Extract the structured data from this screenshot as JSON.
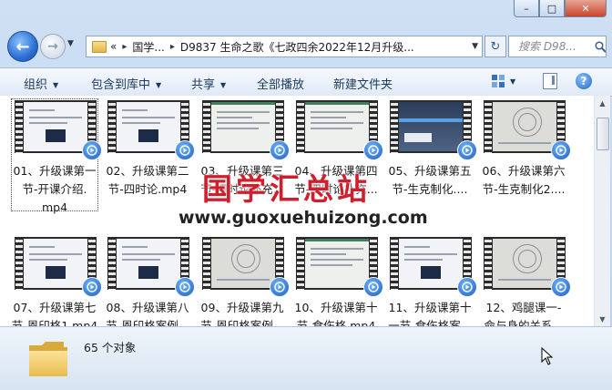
{
  "window": {
    "minimize_glyph": "–",
    "maximize_glyph": "□",
    "close_glyph": "✕"
  },
  "address": {
    "chevrons": "«",
    "segments": [
      "国学...",
      "D9837 生命之歌《七政四余2022年12月升级..."
    ],
    "separator": "▸"
  },
  "search": {
    "placeholder": "搜索 D98..."
  },
  "toolbar": {
    "organize": "组织",
    "include_in_library": "包含到库中",
    "share": "共享",
    "play_all": "全部播放",
    "new_folder": "新建文件夹"
  },
  "files": [
    {
      "label": "01、升级课第一节-开课介绍.mp4",
      "line1": "01、升级课第一",
      "line2": "节-开课介绍.",
      "line3": "mp4",
      "thumb": "a",
      "selected": true
    },
    {
      "label": "02、升级课第二节-四时论.mp4",
      "line1": "02、升级课第二",
      "line2": "节-四时论.mp4",
      "line3": "",
      "thumb": "a",
      "selected": false
    },
    {
      "label": "03、升级课第三节-四时论补充...",
      "line1": "03、升级课第三",
      "line2": "节-四时论补充...",
      "line3": "",
      "thumb": "c",
      "selected": false
    },
    {
      "label": "04、升级课第四节-四时论补充...",
      "line1": "04、升级课第四",
      "line2": "节-四时论补充...",
      "line3": "",
      "thumb": "c",
      "selected": false
    },
    {
      "label": "05、升级课第五节-生克制化....",
      "line1": "05、升级课第五",
      "line2": "节-生克制化....",
      "line3": "",
      "thumb": "b",
      "selected": false
    },
    {
      "label": "06、升级课第六节-生克制化2....",
      "line1": "06、升级课第六",
      "line2": "节-生克制化2....",
      "line3": "",
      "thumb": "d",
      "selected": false
    },
    {
      "label": "07、升级课第七节-恩印格1.mp4",
      "line1": "07、升级课第七",
      "line2": "节-恩印格1.mp4",
      "line3": "",
      "thumb": "a",
      "selected": false
    },
    {
      "label": "08、升级课第八节-恩印格案例...",
      "line1": "08、升级课第八",
      "line2": "节-恩印格案例...",
      "line3": "",
      "thumb": "a",
      "selected": false
    },
    {
      "label": "09、升级课第九节-恩印格案例...",
      "line1": "09、升级课第九",
      "line2": "节-恩印格案例...",
      "line3": "",
      "thumb": "d",
      "selected": false
    },
    {
      "label": "10、升级课第十节-食伤格.mp4",
      "line1": "10、升级课第十",
      "line2": "节-食伤格.mp4",
      "line3": "",
      "thumb": "c",
      "selected": false
    },
    {
      "label": "11、升级课第十一节-食伤格案...",
      "line1": "11、升级课第十",
      "line2": "一节-食伤格案...",
      "line3": "",
      "thumb": "a",
      "selected": false
    },
    {
      "label": "12、鸡腿课一-命与身的关系...",
      "line1": "12、鸡腿课一-",
      "line2": "命与身的关系...",
      "line3": "",
      "thumb": "d",
      "selected": false
    }
  ],
  "watermark": {
    "cn": "国学汇总站",
    "url": "www.guoxuehuizong.com"
  },
  "status": {
    "item_count": "65 个对象"
  },
  "colors": {
    "accent": "#2466c2",
    "watermark_red": "#d01f2c"
  }
}
